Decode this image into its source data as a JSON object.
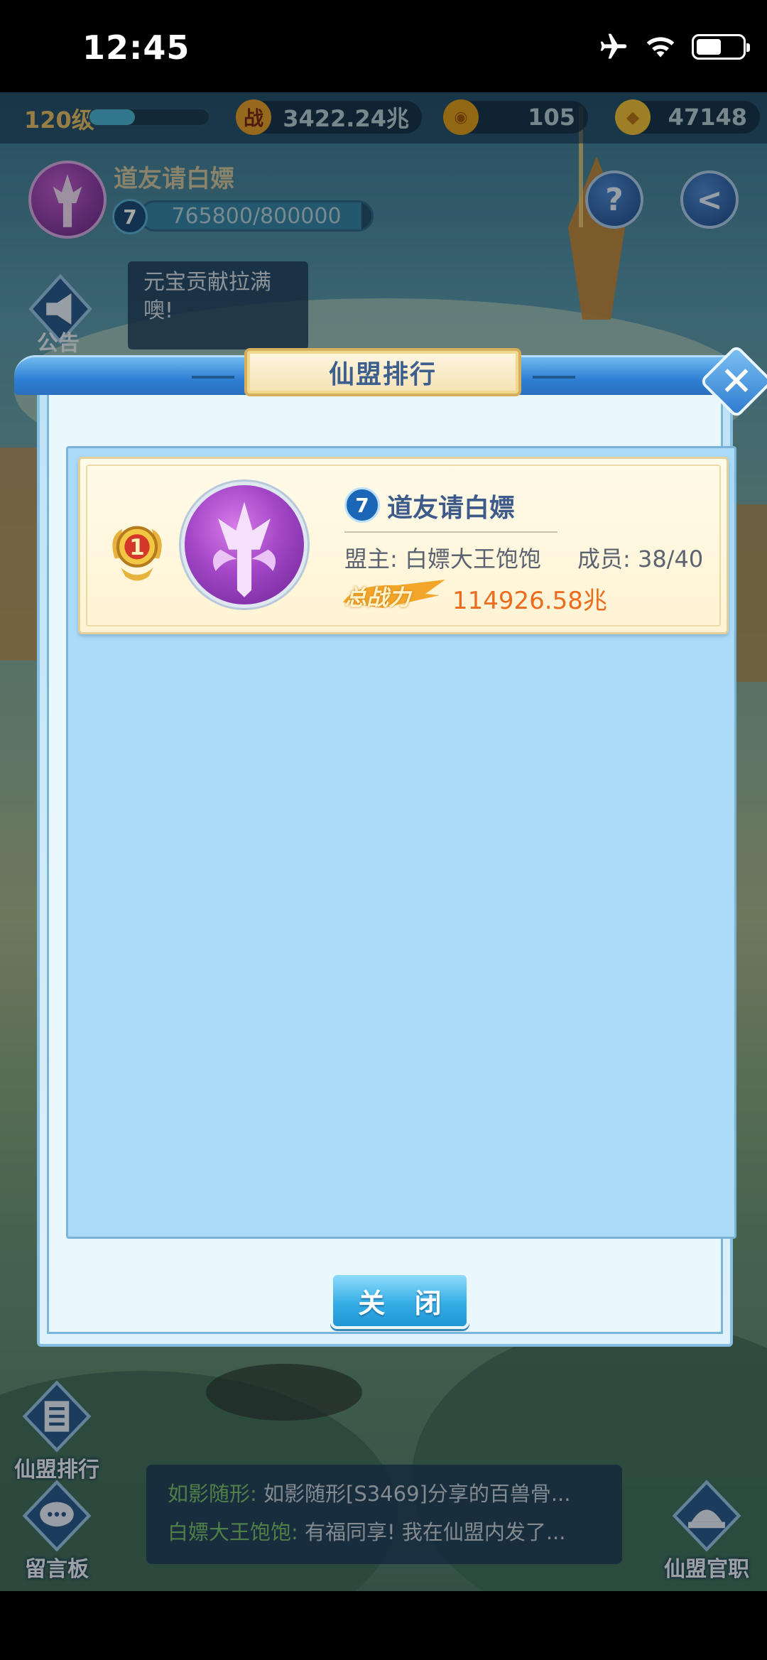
{
  "status_bar": {
    "time": "12:45"
  },
  "top_bar": {
    "level": "120级",
    "exp_fraction": 0.38,
    "combat_power": "3422.24兆",
    "coins": "105",
    "gold_ingots": "47148"
  },
  "alliance_header": {
    "name": "道友请白嫖",
    "level": "7",
    "progress": "765800/800000",
    "progress_fraction": 0.957
  },
  "notice": {
    "label": "公告",
    "bubble_lines": [
      "元宝贡献拉满",
      "噢!"
    ]
  },
  "modal": {
    "title": "仙盟排行",
    "close_button": "关 闭",
    "rankings": [
      {
        "rank": "1",
        "level": "7",
        "name": "道友请白嫖",
        "leader": "盟主: 白嫖大王饱饱",
        "members": "成员: 38/40",
        "power_label": "总战力",
        "power": "114926.58兆"
      }
    ]
  },
  "side_buttons": {
    "ranking": "仙盟排行",
    "message_board": "留言板",
    "official": "仙盟官职"
  },
  "chat": {
    "lines": [
      {
        "speaker": "如影随形:",
        "text": " 如影随形[S3469]分享的百兽骨..."
      },
      {
        "speaker": "白嫖大王饱饱:",
        "text": " 有福同享! 我在仙盟内发了..."
      }
    ]
  },
  "colors": {
    "accent_blue": "#2e7fd4",
    "power_orange": "#ec6c1e",
    "gold": "#d6ae5c"
  }
}
